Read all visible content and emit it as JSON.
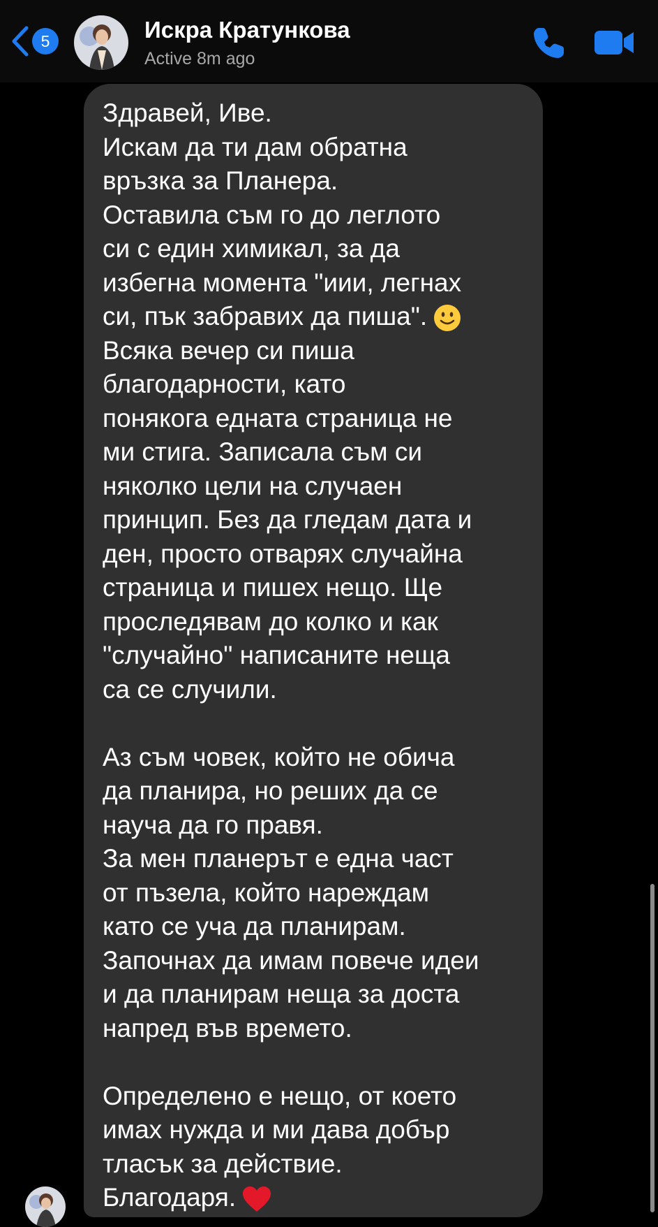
{
  "header": {
    "back_badge": "5",
    "contact_name": "Искра Кратункова",
    "status": "Active 8m ago",
    "back_icon": "chevron-left-icon",
    "call_icon": "phone-icon",
    "video_icon": "video-camera-icon"
  },
  "colors": {
    "accent": "#1e7cf0",
    "bubble": "#303030",
    "background": "#000000",
    "status_text": "#a8a8a8"
  },
  "message": {
    "lines": [
      "Здравей, Иве.",
      "Искам да ти дам обратна",
      "връзка за Планера.",
      "Оставила съм го до леглото",
      "си с един химикал, за да",
      "избегна момента \"иии, легнах",
      "си, пък забравих да пиша\".",
      "Всяка вечер си пиша",
      "благодарности, като",
      "понякога едната страница не",
      "ми стига. Записала съм си",
      "няколко цели на случаен",
      "принцип. Без да гледам дата и",
      "ден, просто отварях случайна",
      "страница и пишех нещо. Ще",
      "проследявам до колко и как",
      "\"случайно\" написаните неща",
      "са се случили.",
      "",
      "Аз съм човек, който не обича",
      "да планира, но реших да се",
      "науча да го правя.",
      "За мен планерът е една част",
      "от пъзела, който нареждам",
      "като се уча да планирам.",
      "Започнах да имам повече идеи",
      "и да планирам неща за доста",
      "напред във времето.",
      "",
      "Определено е нещо, от което",
      "имах нужда и ми дава добър",
      "тласък за действие.",
      "Благодаря."
    ],
    "emoji_1": "slightly-smiling-face-emoji",
    "emoji_2": "red-heart-emoji"
  }
}
